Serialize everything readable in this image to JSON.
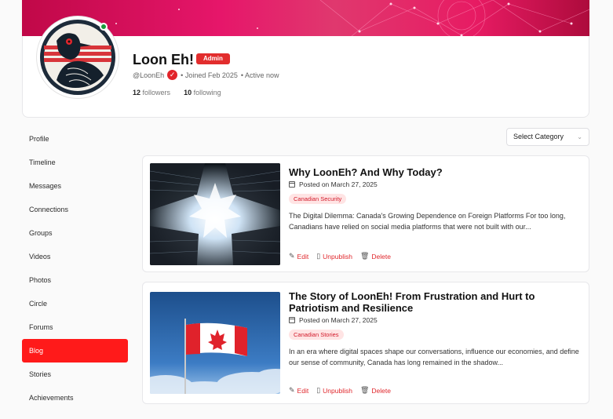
{
  "profile": {
    "name": "Loon Eh!",
    "badge": "Admin",
    "handle": "@LoonEh",
    "joined": "• Joined Feb 2025",
    "status": "• Active now",
    "followers_count": "12",
    "followers_label": "followers",
    "following_count": "10",
    "following_label": "following"
  },
  "sidebar": {
    "items": [
      {
        "label": "Profile"
      },
      {
        "label": "Timeline"
      },
      {
        "label": "Messages"
      },
      {
        "label": "Connections"
      },
      {
        "label": "Groups"
      },
      {
        "label": "Videos"
      },
      {
        "label": "Photos"
      },
      {
        "label": "Circle"
      },
      {
        "label": "Forums"
      },
      {
        "label": "Blog",
        "active": true
      },
      {
        "label": "Stories"
      },
      {
        "label": "Achievements"
      }
    ]
  },
  "filter": {
    "category_label": "Select Category"
  },
  "posts": [
    {
      "title": "Why LoonEh? And Why Today?",
      "date": "Posted on March 27, 2025",
      "tag": "Canadian Security",
      "excerpt": "The Digital Dilemma: Canada's Growing Dependence on Foreign Platforms For too long, Canadians have relied on social media platforms that were not built with our...",
      "edit": "Edit",
      "unpublish": "Unpublish",
      "delete": "Delete"
    },
    {
      "title": "The Story of LoonEh! From Frustration and Hurt to Patriotism and Resilience",
      "date": "Posted on March 27, 2025",
      "tag": "Canadian Stories",
      "excerpt": "In an era where digital spaces shape our conversations, influence our economies, and define our sense of community, Canada has long remained in the shadow...",
      "edit": "Edit",
      "unpublish": "Unpublish",
      "delete": "Delete"
    }
  ],
  "colors": {
    "accent": "#ff1a1a",
    "cover": "#e6166a",
    "online": "#1a9c3b"
  },
  "icons": {
    "verified": "check-badge-icon",
    "calendar": "calendar-icon",
    "edit": "edit-icon",
    "unpublish": "document-icon",
    "delete": "trash-icon"
  }
}
